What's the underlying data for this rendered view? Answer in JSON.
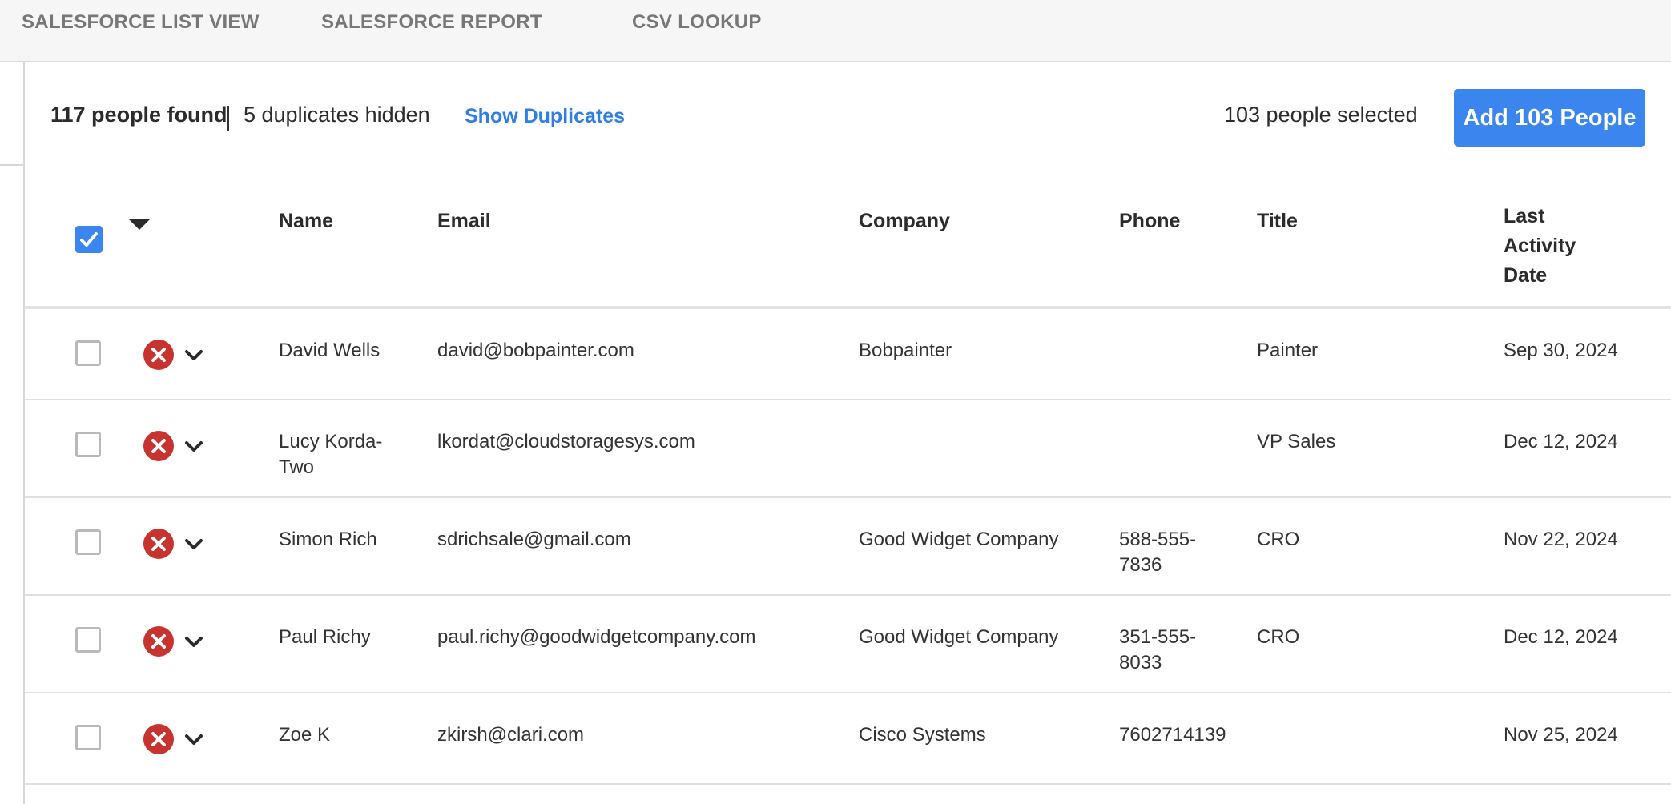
{
  "tabs": [
    "SALESFORCE LIST VIEW",
    "SALESFORCE REPORT",
    "CSV LOOKUP"
  ],
  "summary": {
    "found": "117 people found",
    "duplicates": "5 duplicates hidden",
    "show_duplicates": "Show Duplicates",
    "selected": "103 people selected",
    "add_button": "Add 103 People"
  },
  "table": {
    "headers": {
      "name": "Name",
      "email": "Email",
      "company": "Company",
      "phone": "Phone",
      "title": "Title",
      "last_activity_lines": [
        "Last",
        "Activity",
        "Date"
      ]
    },
    "rows": [
      {
        "name_lines": [
          "David Wells"
        ],
        "email": "david@bobpainter.com",
        "company": "Bobpainter",
        "phone_lines": [],
        "title": "Painter",
        "date": "Sep 30, 2024"
      },
      {
        "name_lines": [
          "Lucy Korda-",
          "Two"
        ],
        "email": "lkordat@cloudstoragesys.com",
        "company": "",
        "phone_lines": [],
        "title": "VP Sales",
        "date": "Dec 12, 2024"
      },
      {
        "name_lines": [
          "Simon Rich"
        ],
        "email": "sdrichsale@gmail.com",
        "company": "Good Widget Company",
        "phone_lines": [
          "588-555-",
          "7836"
        ],
        "title": "CRO",
        "date": "Nov 22, 2024"
      },
      {
        "name_lines": [
          "Paul Richy"
        ],
        "email": "paul.richy@goodwidgetcompany.com",
        "company": "Good Widget Company",
        "phone_lines": [
          "351-555-",
          "8033"
        ],
        "title": "CRO",
        "date": "Dec 12, 2024"
      },
      {
        "name_lines": [
          "Zoe K"
        ],
        "email": "zkirsh@clari.com",
        "company": "Cisco Systems",
        "phone_lines": [
          "7602714139"
        ],
        "title": "",
        "date": "Nov 25, 2024"
      }
    ]
  },
  "icons": {
    "header_checkbox": "checkbox-checked-icon",
    "sort": "caret-down-icon",
    "row_remove": "remove-circle-icon",
    "row_expand": "chevron-down-icon"
  },
  "colors": {
    "accent": "#3a86ee",
    "link": "#2f7de6",
    "remove": "#c8322f"
  }
}
